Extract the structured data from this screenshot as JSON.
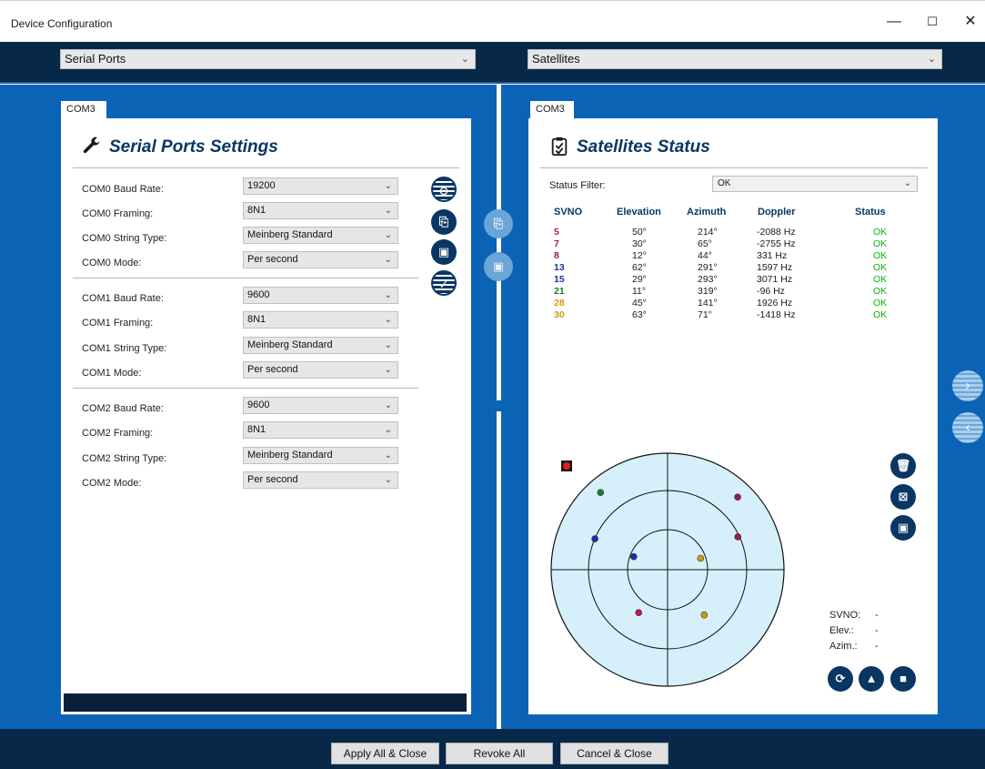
{
  "window": {
    "title": "Device Configuration",
    "controls": {
      "minimize": "—",
      "maximize": "☐",
      "close": "✕"
    }
  },
  "top": {
    "left_select": "Serial Ports",
    "right_select": "Satellites"
  },
  "left_panel": {
    "tab": "COM3",
    "title": "Serial Ports Settings",
    "rows": [
      {
        "label": "COM0 Baud Rate:",
        "value": "19200"
      },
      {
        "label": "COM0 Framing:",
        "value": "8N1"
      },
      {
        "label": "COM0 String Type:",
        "value": "Meinberg Standard"
      },
      {
        "label": "COM0 Mode:",
        "value": "Per second"
      },
      {
        "label": "COM1 Baud Rate:",
        "value": "9600"
      },
      {
        "label": "COM1 Framing:",
        "value": "8N1"
      },
      {
        "label": "COM1 String Type:",
        "value": "Meinberg Standard"
      },
      {
        "label": "COM1 Mode:",
        "value": "Per second"
      },
      {
        "label": "COM2 Baud Rate:",
        "value": "9600"
      },
      {
        "label": "COM2 Framing:",
        "value": "8N1"
      },
      {
        "label": "COM2 String Type:",
        "value": "Meinberg Standard"
      },
      {
        "label": "COM2 Mode:",
        "value": "Per second"
      }
    ]
  },
  "right_panel": {
    "tab": "COM3",
    "title": "Satellites Status",
    "filter_label": "Status Filter:",
    "filter_value": "OK",
    "columns": [
      "SVNO",
      "Elevation",
      "Azimuth",
      "Doppler",
      "Status"
    ],
    "satellites": [
      {
        "svno": "5",
        "elevation": "50°",
        "azimuth": "214°",
        "doppler": "-2088 Hz",
        "status": "OK",
        "color": "#c0174f"
      },
      {
        "svno": "7",
        "elevation": "30°",
        "azimuth": "65°",
        "doppler": "-2755 Hz",
        "status": "OK",
        "color": "#a01a4e"
      },
      {
        "svno": "8",
        "elevation": "12°",
        "azimuth": "44°",
        "doppler": "331 Hz",
        "status": "OK",
        "color": "#9b1752"
      },
      {
        "svno": "13",
        "elevation": "62°",
        "azimuth": "291°",
        "doppler": "1597 Hz",
        "status": "OK",
        "color": "#1d2fa8"
      },
      {
        "svno": "15",
        "elevation": "29°",
        "azimuth": "293°",
        "doppler": "3071 Hz",
        "status": "OK",
        "color": "#1d2fa8"
      },
      {
        "svno": "21",
        "elevation": "11°",
        "azimuth": "319°",
        "doppler": "-96 Hz",
        "status": "OK",
        "color": "#1e7d2a"
      },
      {
        "svno": "28",
        "elevation": "45°",
        "azimuth": "141°",
        "doppler": "1926 Hz",
        "status": "OK",
        "color": "#d39a0f"
      },
      {
        "svno": "30",
        "elevation": "63°",
        "azimuth": "71°",
        "doppler": "-1418 Hz",
        "status": "OK",
        "color": "#d39a0f"
      }
    ],
    "legend": {
      "svno_label": "SVNO:",
      "svno_value": "-",
      "elev_label": "Elev.:",
      "elev_value": "-",
      "azim_label": "Azim.:",
      "azim_value": "-"
    }
  },
  "bottom": {
    "apply": "Apply All & Close",
    "revoke": "Revoke All",
    "cancel": "Cancel & Close"
  },
  "colors": {
    "work_bg": "#0b63b6",
    "bar_bg": "#08284a",
    "accent": "#0a3664",
    "ok_green": "#0bb30b",
    "polar_fill": "#d5f0fb"
  },
  "icons": {
    "title_left": "wrench-icon",
    "title_right": "clipboard-check-icon"
  }
}
